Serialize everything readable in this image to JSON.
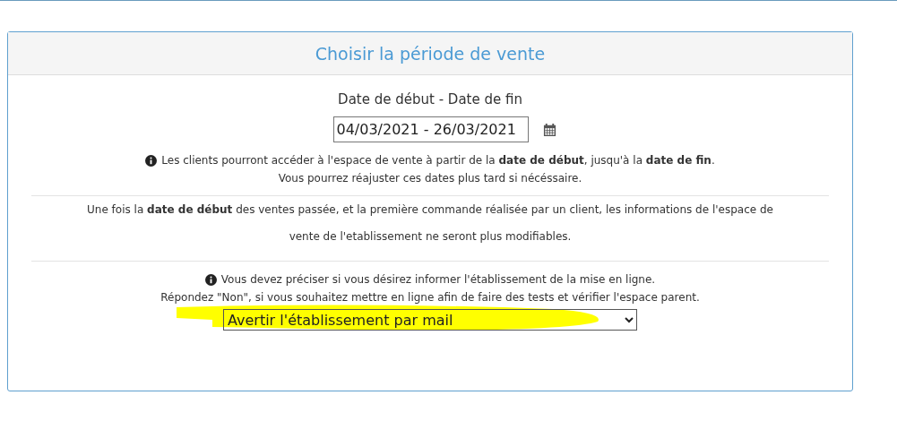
{
  "card": {
    "title": "Choisir la période de vente"
  },
  "date_range": {
    "label": "Date de début - Date de fin",
    "value": "04/03/2021 - 26/03/2021"
  },
  "date_info": [
    "Les clients pourront accéder à l'espace de vente à partir de la **date de début**, jusqu'à la **date de fin**.",
    "Vous pourrez réajuster ces dates plus tard si nécéssaire."
  ],
  "warning": "Une fois la **date de début** des ventes passée, et la première commande réalisée par un client, les informations de l'espace de vente de l'etablissement ne seront plus modifiables.",
  "notify_info": [
    "Vous devez préciser si vous désirez informer l'établissement de la mise en ligne.",
    "Répondez \"Non\", si vous souhaitez mettre en ligne afin de faire des tests et vérifier l'espace parent."
  ],
  "notify_select": {
    "value": "Avertir l'établissement par mail",
    "highlighted": true
  }
}
